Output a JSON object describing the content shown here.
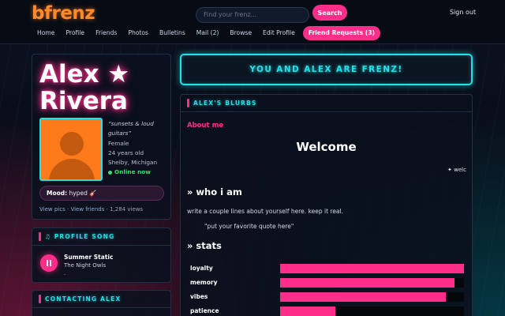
{
  "header": {
    "logo": "bfrenz",
    "search_placeholder": "Find your frenz...",
    "search_button": "Search",
    "signout": "Sign out"
  },
  "nav": {
    "items": [
      "Home",
      "Profile",
      "Friends",
      "Photos",
      "Bulletins",
      "Mail (2)",
      "Browse",
      "Edit Profile"
    ],
    "friend_requests": "Friend Requests (3)"
  },
  "profile": {
    "name_line1": "Alex ★",
    "name_line2": "Rivera",
    "tagline": "“sunsets & loud guitars”",
    "gender": "Female",
    "age": "24 years old",
    "location": "Shelby, Michigan",
    "status": "Online now",
    "mood_label": "Mood:",
    "mood_value": "hyped 🎸",
    "view_pics": "View pics",
    "separator": "·",
    "view_friends": "View friends",
    "views": "1,284 views"
  },
  "song": {
    "section_title": "♫ PROFILE SONG",
    "title": "Summer Static",
    "artist": "The Night Owls",
    "dot": "."
  },
  "contact": {
    "section_title": "CONTACTING ALEX"
  },
  "banner": {
    "text": "YOU AND ALEX ARE FRENZ!"
  },
  "blurbs": {
    "section_title": "ALEX'S BLURBS",
    "about_label": "About me",
    "welcome": "Welcome",
    "marquee": "✦ welcome to my page ✦",
    "who_heading": "» who i am",
    "who_text": "write a couple lines about yourself here. keep it real.",
    "quote": "\"put your favorite quote here\"",
    "stats_heading": "» stats",
    "stats": [
      {
        "label": "loyalty",
        "value": 100
      },
      {
        "label": "memory",
        "value": 95
      },
      {
        "label": "vibes",
        "value": 90
      },
      {
        "label": "patience",
        "value": 30
      }
    ]
  },
  "colors": {
    "accent_pink": "#ff2e8a",
    "accent_cyan": "#24e0e8",
    "logo_orange": "#ff8a2b",
    "online_green": "#39e06a"
  },
  "icons": [
    "play-pause-icon",
    "music-note-icon",
    "star-icon",
    "guitar-icon"
  ]
}
